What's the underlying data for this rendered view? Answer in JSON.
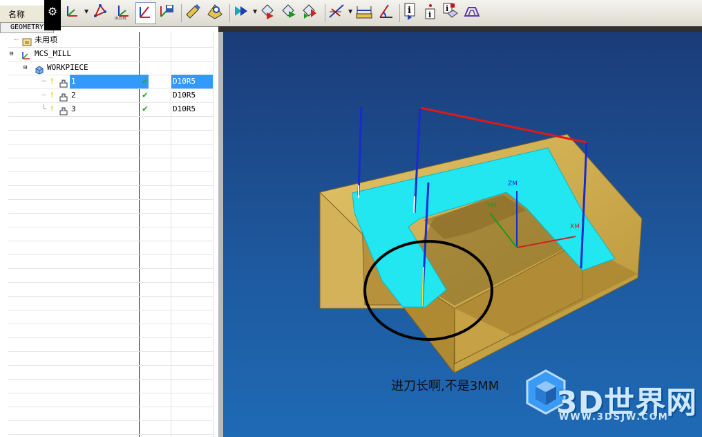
{
  "navigator": {
    "column_name_header": "名称",
    "view_label": "GEOMETRY",
    "rows": [
      {
        "label": "未用项"
      },
      {
        "label": "MCS_MILL"
      },
      {
        "label": "WORKPIECE"
      },
      {
        "label": "1",
        "tool": "D10R5",
        "status": "ok"
      },
      {
        "label": "2",
        "tool": "D10R5",
        "status": "ok"
      },
      {
        "label": "3",
        "tool": "D10R5",
        "status": "ok"
      }
    ],
    "selected_row": "1"
  },
  "toolbar": {
    "icons": [
      "csys-icon",
      "point-icon",
      "origin-csys-icon",
      "dynamic-csys-icon",
      "save-csys-icon",
      "edit-icon",
      "verify-icon",
      "generate-icon",
      "replay-icon",
      "post-icon",
      "output-icon",
      "measure-icon",
      "dimension-icon",
      "angle-icon",
      "info-icon",
      "object-info-icon",
      "properties-icon",
      "toolpath-icon"
    ]
  },
  "viewport": {
    "annotation": "进刀长啊,不是3MM",
    "axes": {
      "x": "XM",
      "y": "YM",
      "z": "ZM"
    },
    "watermark": {
      "title": "3D世界网",
      "url": "WWW.3DSJW.COM"
    },
    "colors": {
      "background": "#1e5aa0",
      "part": "#d9b659",
      "cut_region": "#22e6f0",
      "toolpath": "#1a2ad0",
      "retract": "#e01818"
    }
  }
}
